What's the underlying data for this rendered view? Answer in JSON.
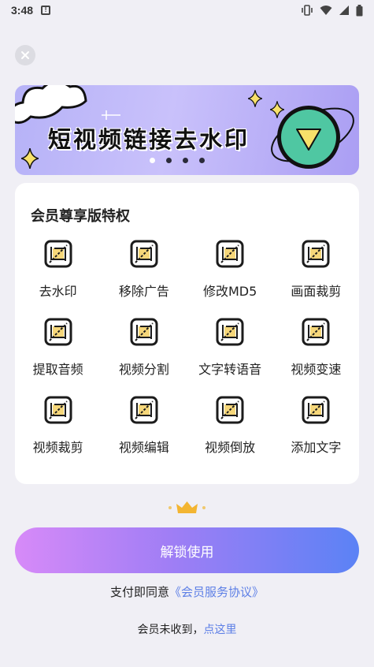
{
  "status_bar": {
    "time": "3:48"
  },
  "banner": {
    "title": "短视频链接去水印",
    "dots": [
      true,
      false,
      false,
      false
    ]
  },
  "privileges": {
    "title": "会员尊享版特权",
    "features": [
      {
        "label": "去水印"
      },
      {
        "label": "移除广告"
      },
      {
        "label": "修改MD5"
      },
      {
        "label": "画面裁剪"
      },
      {
        "label": "提取音频"
      },
      {
        "label": "视频分割"
      },
      {
        "label": "文字转语音"
      },
      {
        "label": "视频变速"
      },
      {
        "label": "视频裁剪"
      },
      {
        "label": "视频编辑"
      },
      {
        "label": "视频倒放"
      },
      {
        "label": "添加文字"
      }
    ]
  },
  "unlock_button": {
    "label": "解锁使用"
  },
  "agreement": {
    "prefix": "支付即同意",
    "link": "《会员服务协议》"
  },
  "help": {
    "prefix": "会员未收到，",
    "link": "点这里"
  },
  "colors": {
    "accent_link": "#5d7fe6",
    "icon_yellow": "#f6d77a",
    "button_start": "#d78af8",
    "button_end": "#5b82f5",
    "crown": "#f3b532"
  }
}
